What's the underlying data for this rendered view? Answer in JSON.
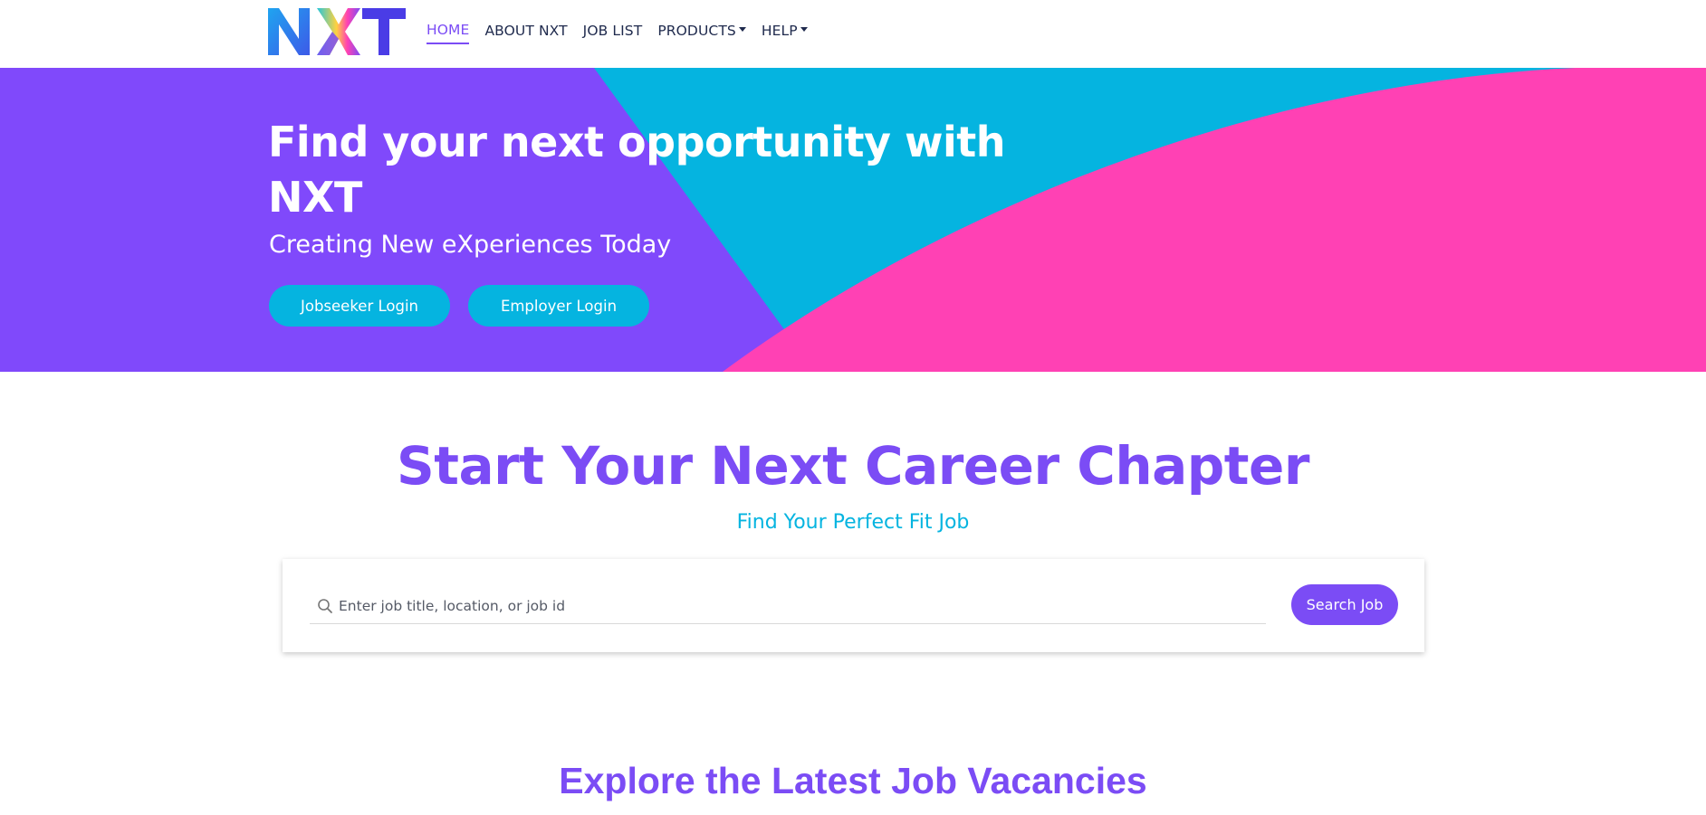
{
  "brand": {
    "logo_text": "NXT",
    "colors": {
      "purple": "#7b4cf5",
      "cyan": "#05b4e0",
      "pink": "#ff41b4",
      "navy": "#1f2a4d"
    }
  },
  "nav": {
    "items": [
      {
        "label": "HOME",
        "active": true
      },
      {
        "label": "ABOUT NXT"
      },
      {
        "label": "JOB LIST"
      },
      {
        "label": "PRODUCTS",
        "dropdown": true
      },
      {
        "label": "HELP",
        "dropdown": true
      }
    ]
  },
  "hero": {
    "title": "Find your next opportunity with NXT",
    "subtitle": "Creating New eXperiences Today",
    "jobseeker_label": "Jobseeker Login",
    "employer_label": "Employer Login"
  },
  "career": {
    "title": "Start Your Next Career Chapter",
    "subtitle": "Find Your Perfect Fit Job"
  },
  "search": {
    "icon": "search-icon",
    "placeholder": "Enter job title, location, or job id",
    "value": "",
    "button_label": "Search Job"
  },
  "vacancies": {
    "title": "Explore the Latest Job Vacancies"
  }
}
